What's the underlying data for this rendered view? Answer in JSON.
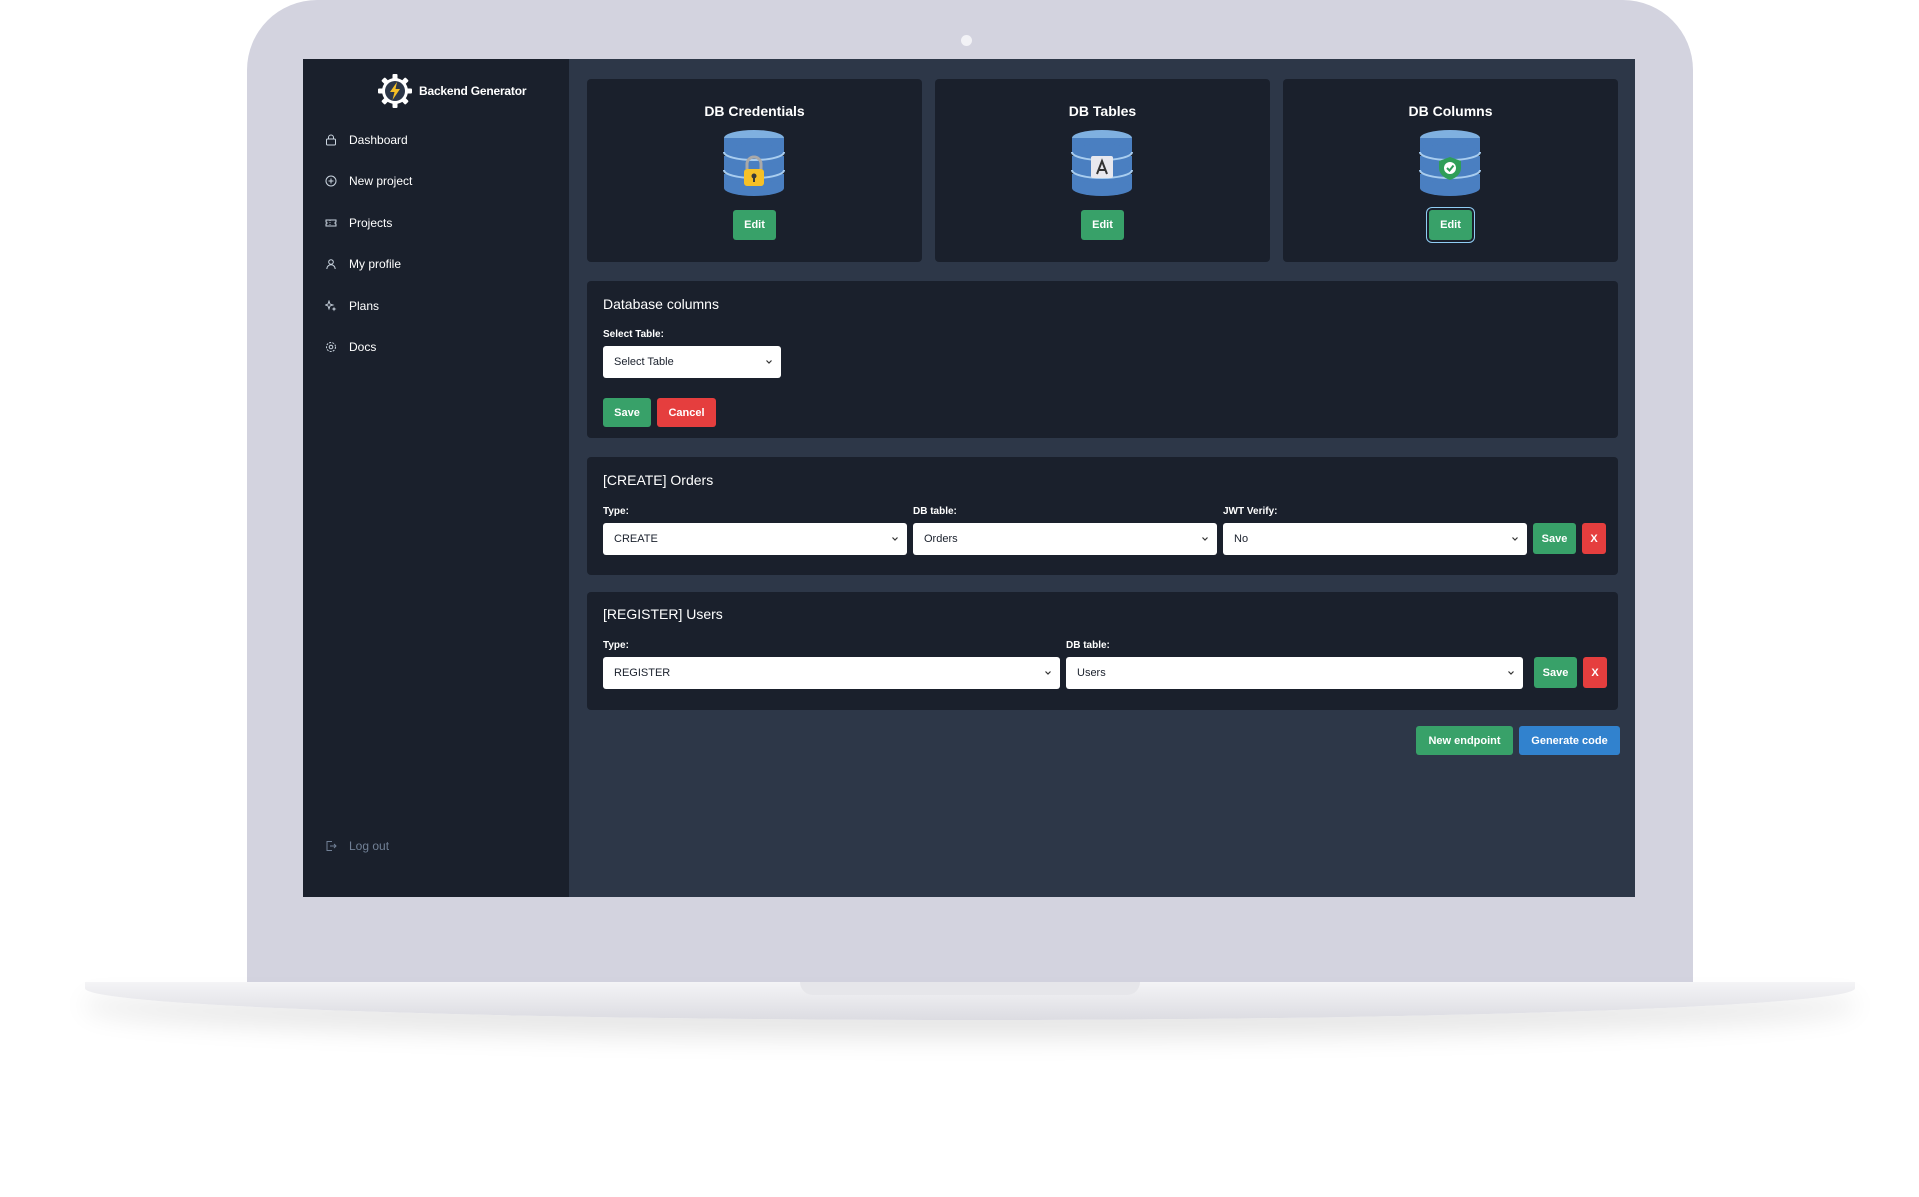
{
  "app": {
    "name": "Backend Generator"
  },
  "sidebar": {
    "items": [
      {
        "label": "Dashboard",
        "icon": "lock-icon"
      },
      {
        "label": "New project",
        "icon": "plus-circle-icon"
      },
      {
        "label": "Projects",
        "icon": "ticket-icon"
      },
      {
        "label": "My profile",
        "icon": "user-icon"
      },
      {
        "label": "Plans",
        "icon": "sparkles-icon"
      },
      {
        "label": "Docs",
        "icon": "gear-icon"
      }
    ],
    "logout_label": "Log out"
  },
  "db_cards": [
    {
      "title": "DB Credentials",
      "icon": "database-lock-icon",
      "edit_label": "Edit"
    },
    {
      "title": "DB Tables",
      "icon": "database-table-icon",
      "edit_label": "Edit"
    },
    {
      "title": "DB Columns",
      "icon": "database-check-icon",
      "edit_label": "Edit"
    }
  ],
  "db_columns_form": {
    "title": "Database columns",
    "select_label": "Select Table:",
    "select_value": "Select Table",
    "save_label": "Save",
    "cancel_label": "Cancel"
  },
  "endpoints": [
    {
      "title": "[CREATE] Orders",
      "type_label": "Type:",
      "type_value": "CREATE",
      "table_label": "DB table:",
      "table_value": "Orders",
      "jwt_label": "JWT Verify:",
      "jwt_value": "No",
      "save_label": "Save",
      "delete_label": "X"
    },
    {
      "title": "[REGISTER] Users",
      "type_label": "Type:",
      "type_value": "REGISTER",
      "table_label": "DB table:",
      "table_value": "Users",
      "save_label": "Save",
      "delete_label": "X"
    }
  ],
  "actions": {
    "new_endpoint_label": "New endpoint",
    "generate_label": "Generate code"
  },
  "colors": {
    "sidebar_bg": "#1a202c",
    "main_bg": "#2d3748",
    "green": "#38a169",
    "red": "#e53e3e",
    "blue": "#3182ce"
  }
}
